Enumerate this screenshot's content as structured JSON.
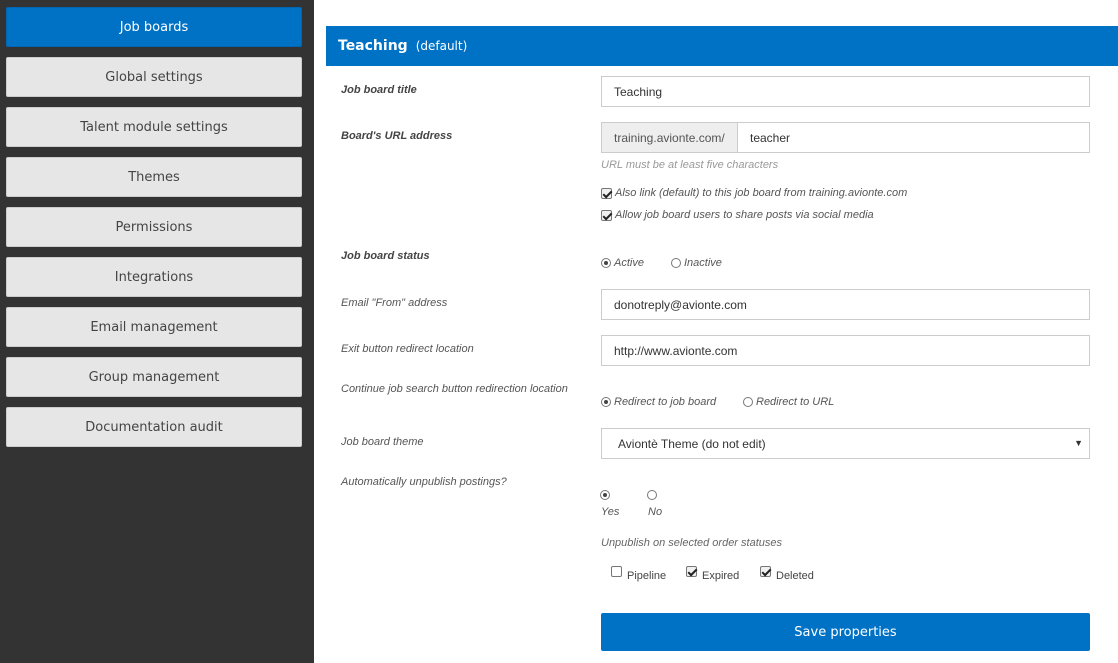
{
  "sidebar": {
    "items": [
      {
        "label": "Job boards",
        "active": true
      },
      {
        "label": "Global settings"
      },
      {
        "label": "Talent module settings"
      },
      {
        "label": "Themes"
      },
      {
        "label": "Permissions"
      },
      {
        "label": "Integrations"
      },
      {
        "label": "Email management"
      },
      {
        "label": "Group management"
      },
      {
        "label": "Documentation audit"
      }
    ]
  },
  "header": {
    "title": "Teaching",
    "subtitle": "(default)"
  },
  "form": {
    "title": {
      "label": "Job board title",
      "value": "Teaching"
    },
    "url": {
      "label": "Board's URL address",
      "prefix": "training.avionte.com/",
      "value": "teacher",
      "hint": "URL must be at least five characters",
      "options": [
        {
          "label": "Also link (default) to this job board from training.avionte.com",
          "checked": true
        },
        {
          "label": "Allow job board users to share posts via social media",
          "checked": true
        }
      ]
    },
    "status": {
      "label": "Job board status",
      "options": [
        {
          "label": "Active",
          "checked": true
        },
        {
          "label": "Inactive",
          "checked": false
        }
      ]
    },
    "email_from": {
      "label": "Email \"From\" address",
      "value": "donotreply@avionte.com"
    },
    "exit_redirect": {
      "label": "Exit button redirect location",
      "value": "http://www.avionte.com"
    },
    "continue_redirect": {
      "label": "Continue job search button redirection location",
      "options": [
        {
          "label": "Redirect to job board",
          "checked": true
        },
        {
          "label": "Redirect to URL",
          "checked": false
        }
      ]
    },
    "theme": {
      "label": "Job board theme",
      "value": "Aviontè Theme (do not edit)"
    },
    "auto_unpublish": {
      "label": "Automatically unpublish postings?",
      "options": [
        {
          "label": "Yes",
          "checked": true
        },
        {
          "label": "No",
          "checked": false
        }
      ],
      "statuses_label": "Unpublish on selected order statuses",
      "statuses": [
        {
          "label": "Pipeline",
          "checked": false
        },
        {
          "label": "Expired",
          "checked": true
        },
        {
          "label": "Deleted",
          "checked": true
        }
      ]
    },
    "save_label": "Save properties"
  },
  "colors": {
    "primary": "#0072c6",
    "sidebar_bg": "#333333",
    "nav_button_bg": "#e6e6e6"
  },
  "icons": {
    "select_arrow": "▼"
  }
}
